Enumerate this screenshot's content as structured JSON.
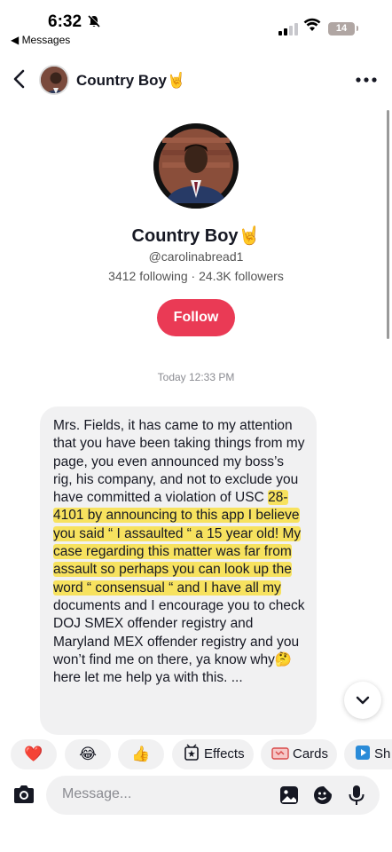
{
  "status_bar": {
    "time": "6:32",
    "back_app": "◀ Messages",
    "battery": "14"
  },
  "header": {
    "name": "Country Boy🤘"
  },
  "profile": {
    "name": "Country Boy🤘",
    "handle": "@carolinabread1",
    "stats": "3412 following · 24.3K followers",
    "follow_label": "Follow"
  },
  "chat": {
    "timestamp": "Today 12:33 PM",
    "message_plain_before": "Mrs. Fields, it has came to my attention that you have been taking things from my page, you even announced my boss’s rig, his company, and not to exclude you have committed a violation of USC ",
    "message_highlighted": "28-4101 by announcing to this app I believe you said “ I assaulted “ a 15 year old! My case regarding this matter was far from assault so perhaps you can look up the word “ consensual “ and I have all my",
    "message_plain_after": " documents and I encourage you to check DOJ SMEX offender registry and Maryland MEX offender registry and you won’t find me on there, ya know why🤔 here let me help ya with this. ..."
  },
  "quick_actions": [
    {
      "emoji": "❤️"
    },
    {
      "emoji": "😂"
    },
    {
      "emoji": "👍"
    },
    {
      "label": "Effects",
      "icon": "effects-icon"
    },
    {
      "label": "Cards",
      "icon": "cards-icon"
    },
    {
      "label": "Sh",
      "icon": "share-icon"
    }
  ],
  "composer": {
    "placeholder": "Message..."
  },
  "colors": {
    "follow_button": "#ea3a55",
    "bubble": "#f1f1f2",
    "highlight": "#f8de36",
    "muted_text": "#8a8b91"
  }
}
